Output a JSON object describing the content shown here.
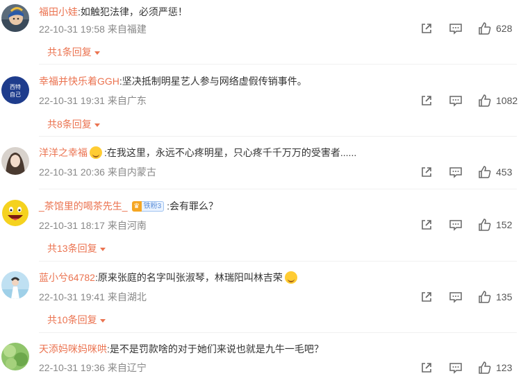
{
  "comments": [
    {
      "username": "福田小娃",
      "text": "如触犯法律，必须严惩！",
      "time": "22-10-31 19:58",
      "location": "来自福建",
      "likes": "628",
      "replies": "共1条回复"
    },
    {
      "username": "幸福并快乐着GGH",
      "text": "坚决抵制明星艺人参与网络虚假传销事件。",
      "time": "22-10-31 19:31",
      "location": "来自广东",
      "likes": "1082",
      "replies": "共8条回复",
      "avatar_text": [
        "西特",
        "自己"
      ]
    },
    {
      "username": "洋洋之幸福",
      "text": "在我这里，永远不心疼明星，只心疼千千万万的受害者......",
      "time": "22-10-31 20:36",
      "location": "来自内蒙古",
      "likes": "453"
    },
    {
      "username": "_茶馆里的喝茶先生_",
      "fan_badge": "铁粉3",
      "text": "会有罪么？",
      "time": "22-10-31 18:17",
      "location": "来自河南",
      "likes": "152",
      "replies": "共13条回复"
    },
    {
      "username": "蓝小兮64782",
      "text": "原来张庭的名字叫张淑琴，林瑞阳叫林吉荣",
      "time": "22-10-31 19:41",
      "location": "来自湖北",
      "likes": "135",
      "replies": "共10条回复"
    },
    {
      "username": "天添妈咪妈咪哄",
      "text": "是不是罚款啥的对于她们来说也就是九牛一毛吧？",
      "time": "22-10-31 19:36",
      "location": "来自辽宁",
      "likes": "123"
    }
  ],
  "colors": {
    "username": "#eb7350",
    "text": "#333333",
    "meta": "#888888",
    "replies": "#eb7350"
  },
  "icons": [
    "share-icon",
    "comment-icon",
    "like-icon",
    "caret-down-icon"
  ]
}
